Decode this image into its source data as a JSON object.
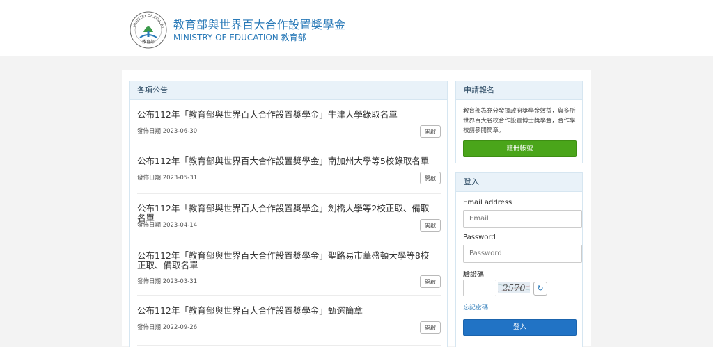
{
  "header": {
    "site_title": "教育部與世界百大合作設置獎學金",
    "site_subtitle": "MINISTRY OF EDUCATION 教育部",
    "logo_text_top": "MINISTRY OF EDUCATION",
    "logo_text_bottom": "教育部"
  },
  "announcements": {
    "heading": "各項公告",
    "items": [
      {
        "title": "公布112年「教育部與世界百大合作設置獎學金」牛津大學錄取名單",
        "date": "發佈日期 2023-06-30",
        "button": "開啟"
      },
      {
        "title": "公布112年「教育部與世界百大合作設置獎學金」南加州大學等5校錄取名單",
        "date": "發佈日期 2023-05-31",
        "button": "開啟"
      },
      {
        "title": "公布112年「教育部與世界百大合作設置獎學金」劍橋大學等2校正取、備取名單",
        "date": "發佈日期 2023-04-14",
        "button": "開啟"
      },
      {
        "title": "公布112年「教育部與世界百大合作設置獎學金」聖路易市華盛頓大學等8校正取、備取名單",
        "date": "發佈日期 2023-03-31",
        "button": "開啟"
      },
      {
        "title": "公布112年「教育部與世界百大合作設置獎學金」甄選簡章",
        "date": "發佈日期 2022-09-26",
        "button": "開啟"
      }
    ]
  },
  "apply": {
    "heading": "申請報名",
    "text": "教育部為充分發揮政府獎學金效益，與多所世界百大名校合作設置博士獎學金，合作學校請參閱簡章。",
    "register_button": "註冊帳號"
  },
  "login": {
    "heading": "登入",
    "email_label": "Email address",
    "email_placeholder": "Email",
    "password_label": "Password",
    "password_placeholder": "Password",
    "captcha_label": "驗證碼",
    "captcha_text": "2570",
    "forgot_link": "忘記密碼",
    "login_button": "登入"
  },
  "colors": {
    "brand_blue": "#2a7ab8",
    "green_button": "#4aa51a",
    "blue_button": "#2173c5"
  },
  "icons": {
    "refresh": "refresh-icon",
    "logo": "ministry-seal-logo"
  }
}
